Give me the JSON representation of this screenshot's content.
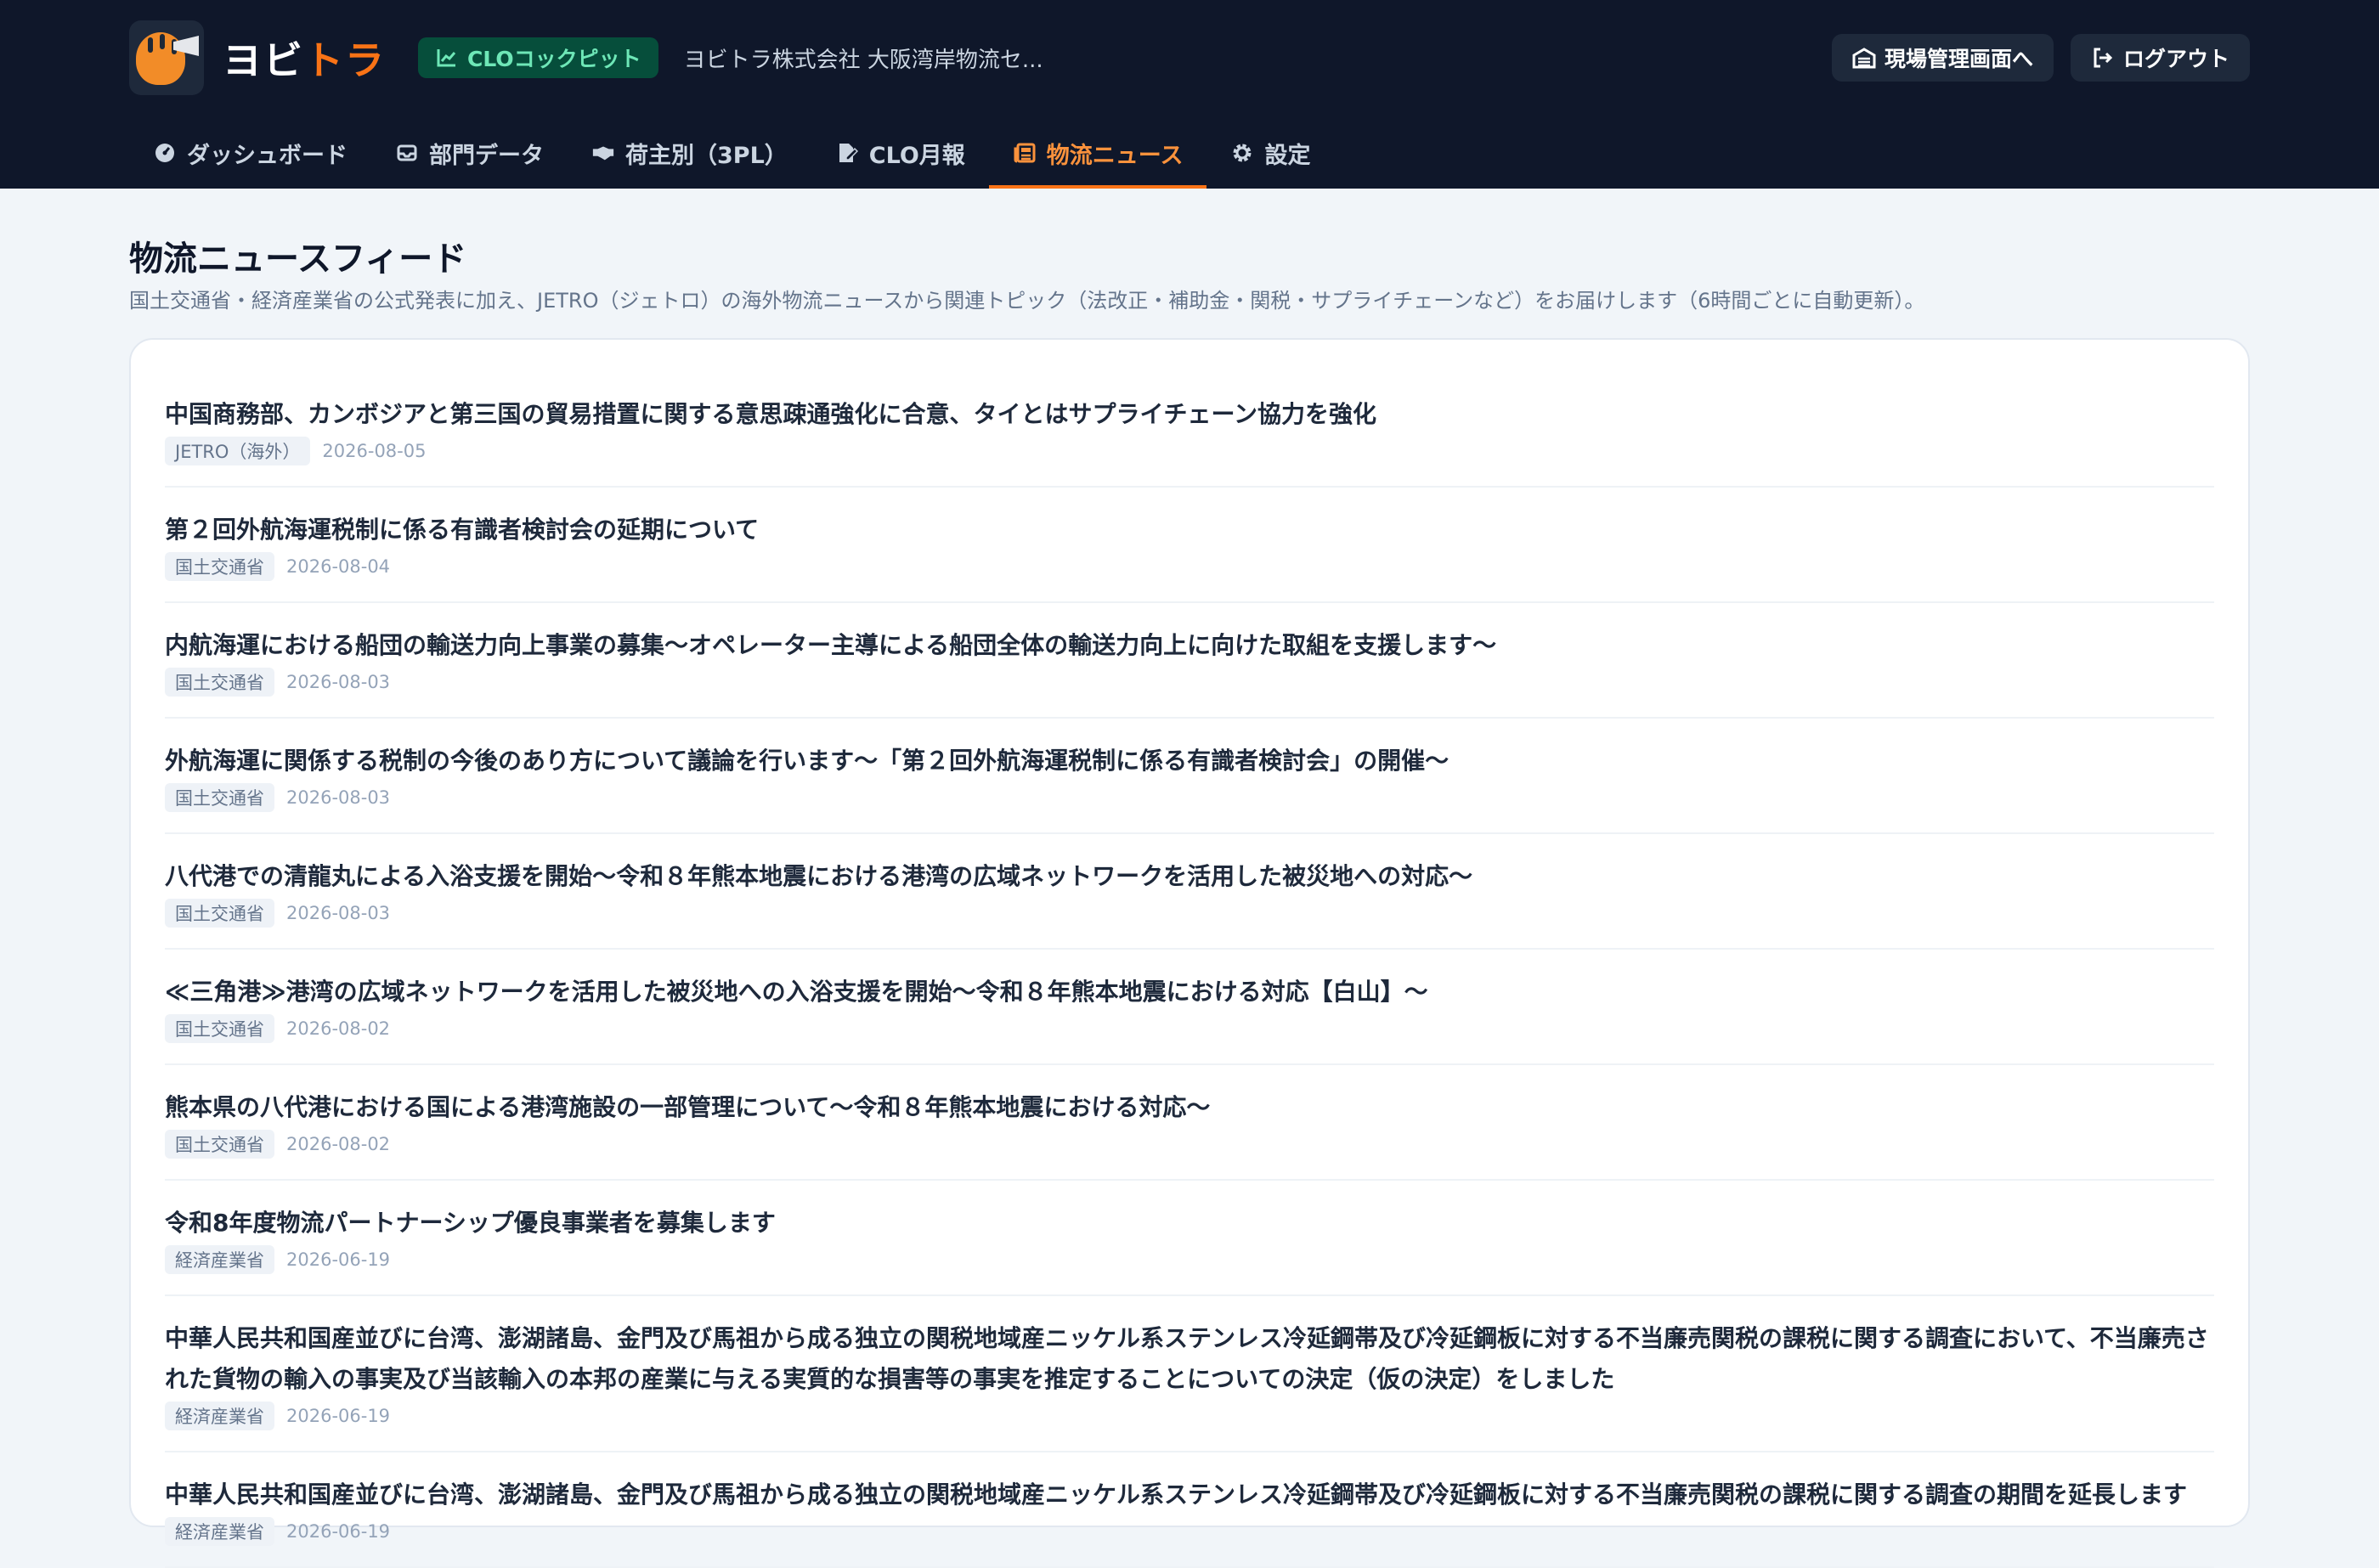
{
  "header": {
    "brand_part1": "ヨビ",
    "brand_part2": "トラ",
    "badge": "CLOコックピット",
    "company": "ヨビトラ株式会社 大阪湾岸物流セ...",
    "site_button": "現場管理画面へ",
    "logout_button": "ログアウト"
  },
  "nav": {
    "items": [
      {
        "label": "ダッシュボード",
        "icon": "gauge-icon"
      },
      {
        "label": "部門データ",
        "icon": "inbox-icon"
      },
      {
        "label": "荷主別（3PL）",
        "icon": "handshake-icon"
      },
      {
        "label": "CLO月報",
        "icon": "file-edit-icon"
      },
      {
        "label": "物流ニュース",
        "icon": "newspaper-icon"
      },
      {
        "label": "設定",
        "icon": "gear-icon"
      }
    ],
    "active_index": 4
  },
  "page": {
    "title": "物流ニュースフィード",
    "description": "国土交通省・経済産業省の公式発表に加え、JETRO（ジェトロ）の海外物流ニュースから関連トピック（法改正・補助金・関税・サプライチェーンなど）をお届けします（6時間ごとに自動更新）。"
  },
  "news": [
    {
      "title": "中国商務部、カンボジアと第三国の貿易措置に関する意思疎通強化に合意、タイとはサプライチェーン協力を強化",
      "source": "JETRO（海外）",
      "date": "2026-08-05"
    },
    {
      "title": "第２回外航海運税制に係る有識者検討会の延期について",
      "source": "国土交通省",
      "date": "2026-08-04"
    },
    {
      "title": "内航海運における船団の輸送力向上事業の募集～オペレーター主導による船団全体の輸送力向上に向けた取組を支援します～",
      "source": "国土交通省",
      "date": "2026-08-03"
    },
    {
      "title": "外航海運に関係する税制の今後のあり方について議論を行います～「第２回外航海運税制に係る有識者検討会」の開催～",
      "source": "国土交通省",
      "date": "2026-08-03"
    },
    {
      "title": "八代港での清龍丸による入浴支援を開始～令和８年熊本地震における港湾の広域ネットワークを活用した被災地への対応～",
      "source": "国土交通省",
      "date": "2026-08-03"
    },
    {
      "title": "≪三角港≫港湾の広域ネットワークを活用した被災地への入浴支援を開始～令和８年熊本地震における対応【白山】～",
      "source": "国土交通省",
      "date": "2026-08-02"
    },
    {
      "title": "熊本県の八代港における国による港湾施設の一部管理について～令和８年熊本地震における対応～",
      "source": "国土交通省",
      "date": "2026-08-02"
    },
    {
      "title": "令和8年度物流パートナーシップ優良事業者を募集します",
      "source": "経済産業省",
      "date": "2026-06-19"
    },
    {
      "title": "中華人民共和国産並びに台湾、澎湖諸島、金門及び馬祖から成る独立の関税地域産ニッケル系ステンレス冷延鋼帯及び冷延鋼板に対する不当廉売関税の課税に関する調査において、不当廉売された貨物の輸入の事実及び当該輸入の本邦の産業に与える実質的な損害等の事実を推定することについての決定（仮の決定）をしました",
      "source": "経済産業省",
      "date": "2026-06-19"
    },
    {
      "title": "中華人民共和国産並びに台湾、澎湖諸島、金門及び馬祖から成る独立の関税地域産ニッケル系ステンレス冷延鋼帯及び冷延鋼板に対する不当廉売関税の課税に関する調査の期間を延長します",
      "source": "経済産業省",
      "date": "2026-06-19"
    }
  ]
}
